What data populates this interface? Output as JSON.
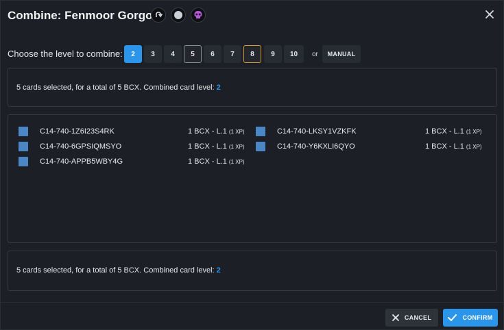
{
  "modal": {
    "title": "Combine: Fenmoor Gorgon",
    "header_icons": [
      "edition-icon",
      "foil-icon",
      "skull-icon"
    ]
  },
  "level_selector": {
    "label": "Choose the level to combine:",
    "levels": [
      "2",
      "3",
      "4",
      "5",
      "6",
      "7",
      "8",
      "9",
      "10"
    ],
    "selected": "2",
    "or_text": "or",
    "manual_label": "MANUAL"
  },
  "summary_top": {
    "text": "5 cards selected, for a total of 5 BCX. Combined card level: ",
    "level": "2"
  },
  "cards": [
    {
      "id": "C14-740-1Z6I23S4RK",
      "info": "1 BCX - L.1 ",
      "xp": "(1 XP)"
    },
    {
      "id": "C14-740-LKSY1VZKFK",
      "info": "1 BCX - L.1 ",
      "xp": "(1 XP)"
    },
    {
      "id": "C14-740-6GPSIQMSYO",
      "info": "1 BCX - L.1 ",
      "xp": "(1 XP)"
    },
    {
      "id": "C14-740-Y6KXLI6QYO",
      "info": "1 BCX - L.1 ",
      "xp": "(1 XP)"
    },
    {
      "id": "C14-740-APPB5WBY4G",
      "info": "1 BCX - L.1 ",
      "xp": "(1 XP)"
    }
  ],
  "summary_bottom": {
    "text": "5 cards selected, for a total of 5 BCX. Combined card level: ",
    "level": "2"
  },
  "footer": {
    "cancel_label": "CANCEL",
    "confirm_label": "CONFIRM"
  },
  "colors": {
    "accent": "#2b95ea",
    "checkbox": "#4a87c4",
    "gold_outline": "#d89a3a",
    "background": "#1c2026"
  }
}
